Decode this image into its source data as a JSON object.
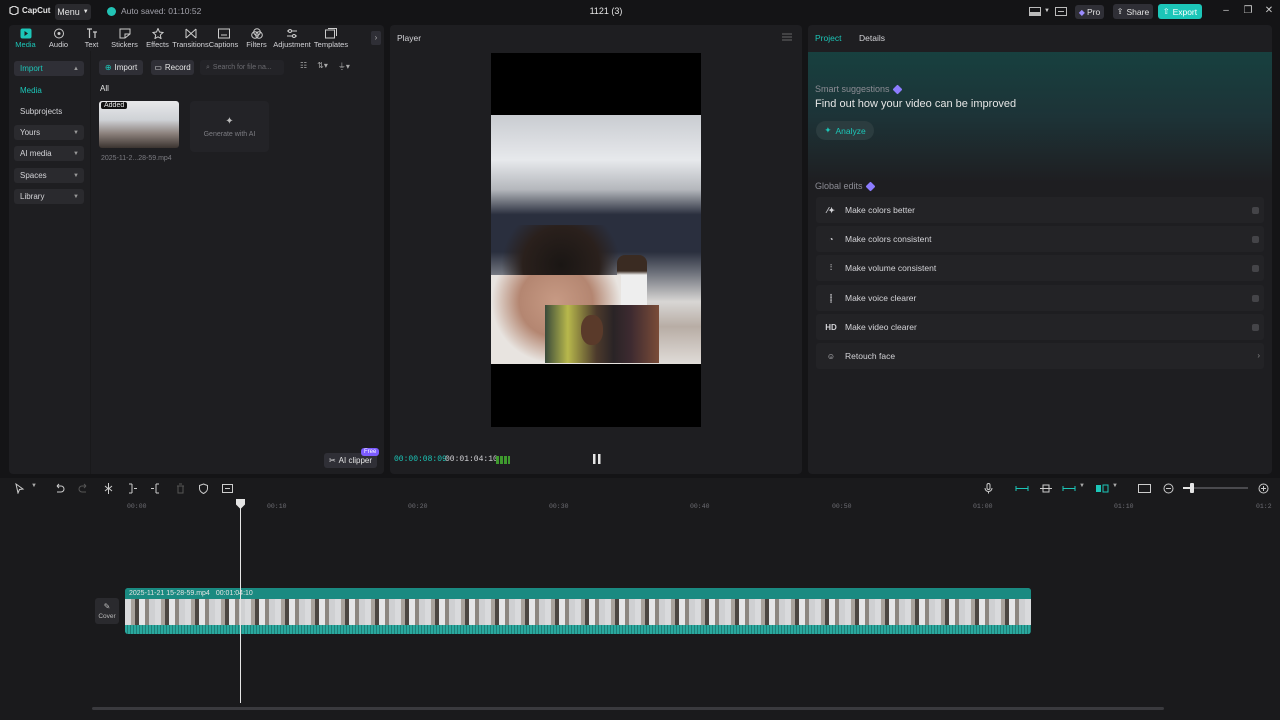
{
  "titlebar": {
    "logo_text": "CapCut",
    "menu_label": "Menu",
    "autosave_text": "Auto saved: 01:10:52",
    "project_title": "1121 (3)",
    "pro_label": "Pro",
    "share_label": "Share",
    "export_label": "Export"
  },
  "toolbar": {
    "tools": [
      "Media",
      "Audio",
      "Text",
      "Stickers",
      "Effects",
      "Transitions",
      "Captions",
      "Filters",
      "Adjustment",
      "Templates"
    ],
    "active": "Media"
  },
  "sidebar": {
    "items": [
      "Import",
      "Media",
      "Subprojects",
      "Yours",
      "AI media",
      "Spaces",
      "Library"
    ]
  },
  "media": {
    "import_label": "Import",
    "record_label": "Record",
    "search_placeholder": "Search for file na...",
    "all_tab": "All",
    "added_badge": "Added",
    "file_name": "2025-11-2...28-59.mp4",
    "generate_ai": "Generate with AI",
    "ai_clipper": "AI clipper",
    "free_badge": "Free"
  },
  "player": {
    "title": "Player",
    "current_time": "00:00:08:09",
    "total_time": "00:01:04:10"
  },
  "right_panel": {
    "tabs": [
      "Project",
      "Details"
    ],
    "smart_title": "Smart suggestions",
    "improve_text": "Find out how your video can be improved",
    "analyze_label": "Analyze",
    "global_title": "Global edits",
    "edits": [
      {
        "label": "Make colors better",
        "icon": "magic-wand-icon"
      },
      {
        "label": "Make colors consistent",
        "icon": "color-match-icon"
      },
      {
        "label": "Make volume consistent",
        "icon": "volume-sliders-icon"
      },
      {
        "label": "Make voice clearer",
        "icon": "voice-wave-icon"
      },
      {
        "label": "Make video clearer",
        "icon": "hd-icon"
      },
      {
        "label": "Retouch face",
        "icon": "face-retouch-icon"
      }
    ]
  },
  "timeline": {
    "ruler_labels": [
      "00:00",
      "00:10",
      "00:20",
      "00:30",
      "00:40",
      "00:50",
      "01:00",
      "01:10",
      "01:2"
    ],
    "clip_name": "2025-11-21 15-28-59.mp4",
    "clip_duration": "00:01:04:10",
    "cover_label": "Cover"
  },
  "colors": {
    "accent": "#1cc6b8",
    "panel": "#1e1e21",
    "background": "#141416"
  }
}
